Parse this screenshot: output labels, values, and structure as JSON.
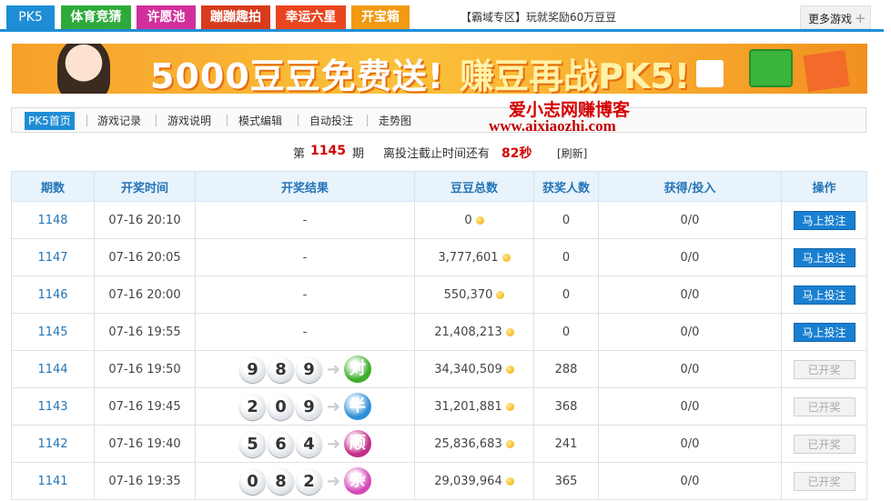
{
  "tabs": [
    {
      "label": "PK5",
      "color": "#1f8dd6"
    },
    {
      "label": "体育竞猜",
      "color": "#2eaa3a"
    },
    {
      "label": "许愿池",
      "color": "#d22e9c"
    },
    {
      "label": "蹦蹦趣拍",
      "color": "#d73b1c"
    },
    {
      "label": "幸运六星",
      "color": "#e8451e"
    },
    {
      "label": "开宝箱",
      "color": "#f19a12"
    }
  ],
  "notice": "【霸域专区】玩就奖励60万豆豆",
  "more_games": "更多游戏",
  "banner": {
    "text1": "5000豆豆免费送!",
    "text2": "赚豆再战PK5!"
  },
  "nav": [
    "PK5首页",
    "游戏记录",
    "游戏说明",
    "模式编辑",
    "自动投注",
    "走势图"
  ],
  "watermark": {
    "line1": "爱小志网赚博客",
    "line2": "www.aixiaozhi.com"
  },
  "countdown": {
    "prefix": "第",
    "period": "1145",
    "suffix": "期",
    "label": "离投注截止时间还有",
    "seconds": "82秒",
    "refresh": "[刷新]"
  },
  "table": {
    "headers": [
      "期数",
      "开奖时间",
      "开奖结果",
      "豆豆总数",
      "获奖人数",
      "获得/投入",
      "操作"
    ],
    "rows": [
      {
        "period": "1148",
        "time": "07-16 20:10",
        "result": "-",
        "balls": [],
        "badge": null,
        "total": "0",
        "winners": "0",
        "ratio": "0/0",
        "action": "马上投注",
        "done": false
      },
      {
        "period": "1147",
        "time": "07-16 20:05",
        "result": "-",
        "balls": [],
        "badge": null,
        "total": "3,777,601",
        "winners": "0",
        "ratio": "0/0",
        "action": "马上投注",
        "done": false
      },
      {
        "period": "1146",
        "time": "07-16 20:00",
        "result": "-",
        "balls": [],
        "badge": null,
        "total": "550,370",
        "winners": "0",
        "ratio": "0/0",
        "action": "马上投注",
        "done": false
      },
      {
        "period": "1145",
        "time": "07-16 19:55",
        "result": "-",
        "balls": [],
        "badge": null,
        "total": "21,408,213",
        "winners": "0",
        "ratio": "0/0",
        "action": "马上投注",
        "done": false
      },
      {
        "period": "1144",
        "time": "07-16 19:50",
        "result": "",
        "balls": [
          "9",
          "8",
          "9"
        ],
        "badge": {
          "text": "对",
          "color": "#3fae2c"
        },
        "total": "34,340,509",
        "winners": "288",
        "ratio": "0/0",
        "action": "已开奖",
        "done": true
      },
      {
        "period": "1143",
        "time": "07-16 19:45",
        "result": "",
        "balls": [
          "2",
          "0",
          "9"
        ],
        "badge": {
          "text": "半",
          "color": "#2f8fd8"
        },
        "total": "31,201,881",
        "winners": "368",
        "ratio": "0/0",
        "action": "已开奖",
        "done": true
      },
      {
        "period": "1142",
        "time": "07-16 19:40",
        "result": "",
        "balls": [
          "5",
          "6",
          "4"
        ],
        "badge": {
          "text": "顺",
          "color": "#c42d8a"
        },
        "total": "25,836,683",
        "winners": "241",
        "ratio": "0/0",
        "action": "已开奖",
        "done": true
      },
      {
        "period": "1141",
        "time": "07-16 19:35",
        "result": "",
        "balls": [
          "0",
          "8",
          "2"
        ],
        "badge": {
          "text": "杂",
          "color": "#d64ab8"
        },
        "total": "29,039,964",
        "winners": "365",
        "ratio": "0/0",
        "action": "已开奖",
        "done": true
      }
    ]
  }
}
